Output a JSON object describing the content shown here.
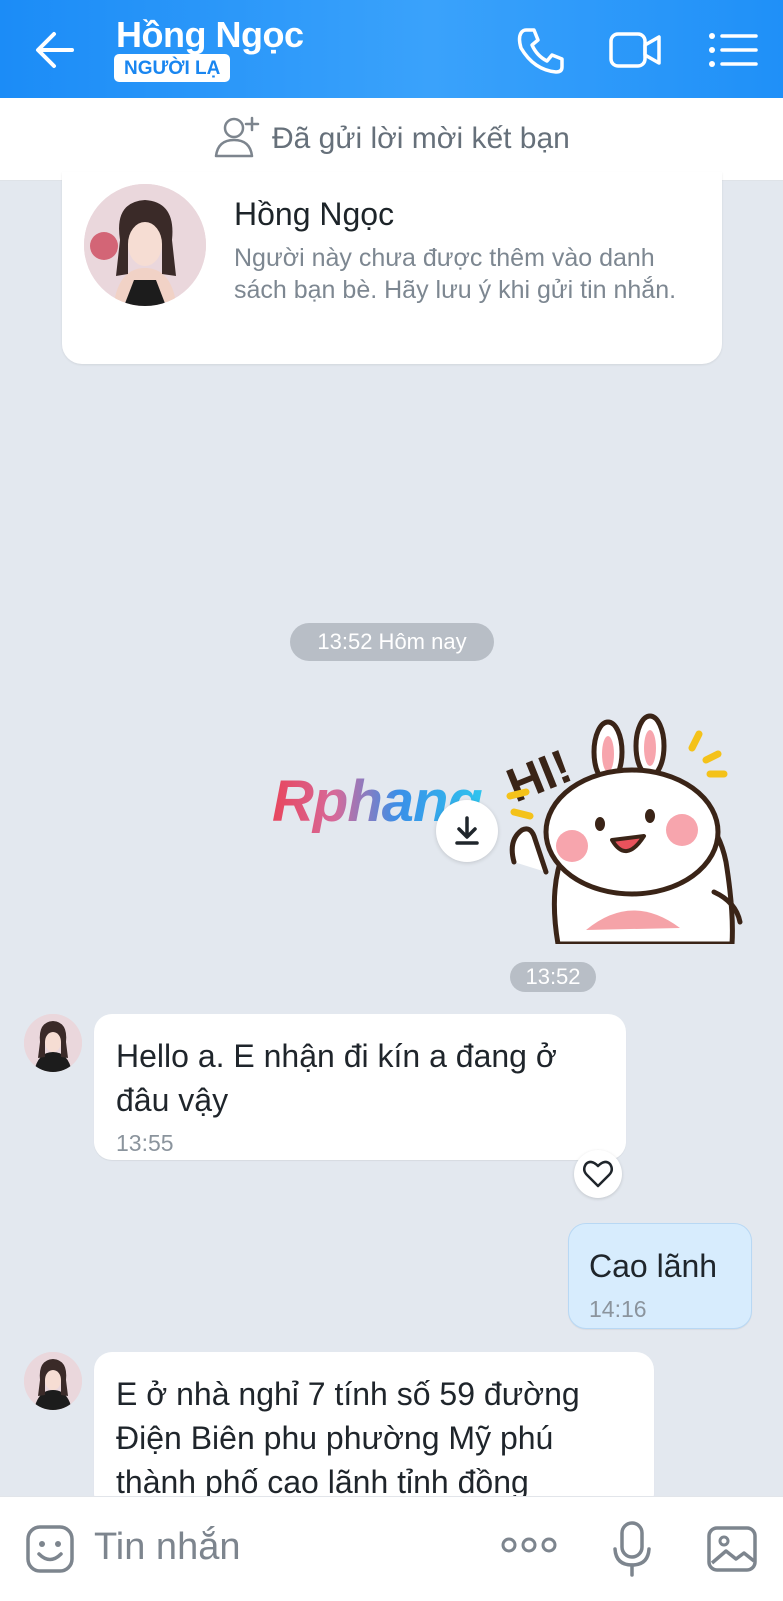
{
  "header": {
    "contact_name": "Hồng Ngọc",
    "badge": "NGƯỜI LẠ",
    "icons": [
      "back-arrow-icon",
      "phone-icon",
      "video-camera-icon",
      "list-menu-icon"
    ]
  },
  "friend_request": {
    "icon": "add-friend-icon",
    "text": "Đã gửi lời mời kết bạn"
  },
  "profile_card": {
    "name": "Hồng Ngọc",
    "note": "Người này chưa được thêm vào danh sách bạn bè. Hãy lưu ý khi gửi tin nhắn."
  },
  "divider_time": "13:52 Hôm nay",
  "sticker": {
    "text": "HI!",
    "time": "13:52",
    "download_icon": "download-icon"
  },
  "watermark": "Rphang",
  "messages": [
    {
      "sender": "contact",
      "text": "Hello a. E nhận đi kín a đang ở đâu vậy",
      "time": "13:55",
      "reaction_icon": "heart-icon"
    },
    {
      "sender": "me",
      "text": "Cao lãnh",
      "time": "14:16"
    },
    {
      "sender": "contact",
      "text": "E ở nhà nghỉ 7 tính số 59 đường Điện Biên phu  phường  Mỹ phú thành phố cao lãnh tỉnh đồng"
    }
  ],
  "input_bar": {
    "placeholder": "Tin nhắn",
    "icons": [
      "emoji-icon",
      "more-options-icon",
      "microphone-icon",
      "image-icon"
    ]
  },
  "colors": {
    "header_blue": "#1b8cf7",
    "chat_background": "#e3e8ef",
    "outgoing_bubble": "#d7ecfd",
    "badge_text": "#1a86f0"
  }
}
